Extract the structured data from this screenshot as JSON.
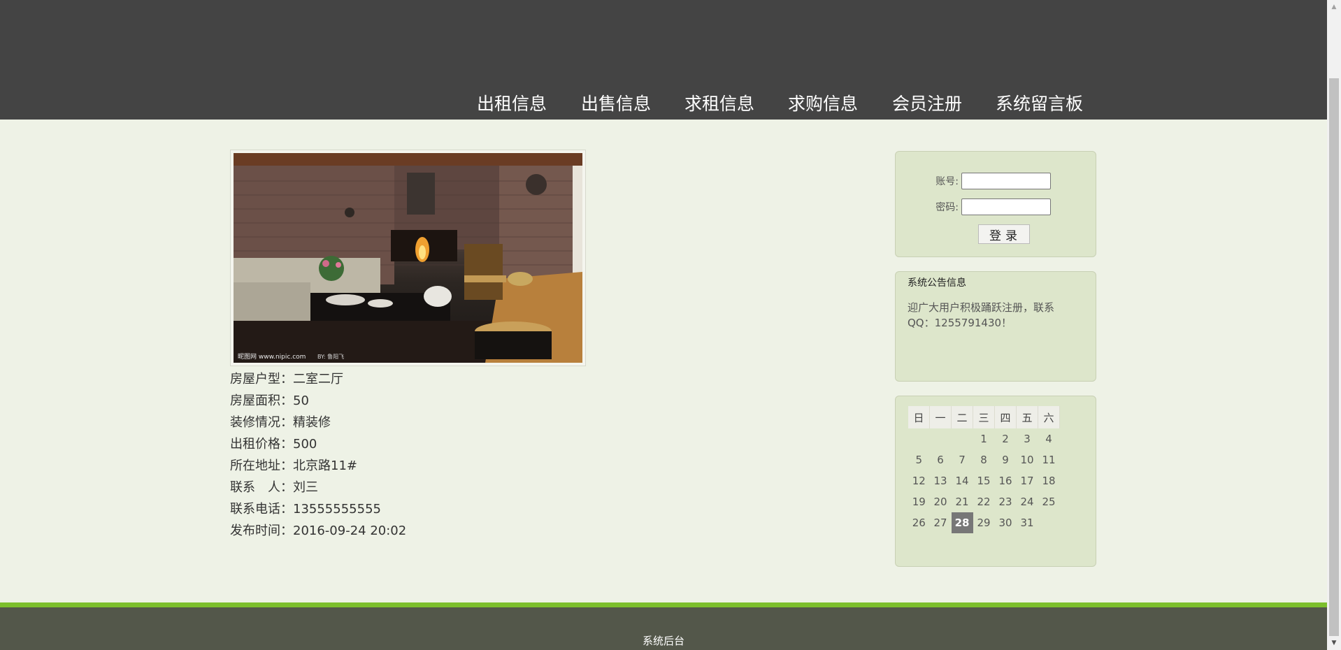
{
  "nav": [
    {
      "label": "出租信息"
    },
    {
      "label": "出售信息"
    },
    {
      "label": "求租信息"
    },
    {
      "label": "求购信息"
    },
    {
      "label": "会员注册"
    },
    {
      "label": "系统留言板"
    }
  ],
  "listing": {
    "image_watermark_left": "昵图网 www.nipic.com",
    "image_watermark_right": "BY: 鲁阳飞",
    "fields": [
      {
        "label": "房屋户型：",
        "value": "二室二厅"
      },
      {
        "label": "房屋面积：",
        "value": "50"
      },
      {
        "label": "装修情况：",
        "value": "精装修"
      },
      {
        "label": "出租价格：",
        "value": "500"
      },
      {
        "label": "所在地址：",
        "value": "北京路11#"
      },
      {
        "label": "联系　人：",
        "value": "刘三"
      },
      {
        "label": "联系电话：",
        "value": "13555555555"
      },
      {
        "label": "发布时间：",
        "value": "2016-09-24 20:02"
      }
    ]
  },
  "login": {
    "account_label": "账号:",
    "password_label": "密码:",
    "account_value": "",
    "password_value": "",
    "submit_label": "登录"
  },
  "notice": {
    "title": "系统公告信息",
    "text": "迎广大用户积极踊跃注册，联系QQ：1255791430！"
  },
  "calendar": {
    "weekdays": [
      "日",
      "一",
      "二",
      "三",
      "四",
      "五",
      "六"
    ],
    "weeks": [
      [
        "",
        "",
        "",
        "1",
        "2",
        "3",
        "4"
      ],
      [
        "5",
        "6",
        "7",
        "8",
        "9",
        "10",
        "11"
      ],
      [
        "12",
        "13",
        "14",
        "15",
        "16",
        "17",
        "18"
      ],
      [
        "19",
        "20",
        "21",
        "22",
        "23",
        "24",
        "25"
      ],
      [
        "26",
        "27",
        "28",
        "29",
        "30",
        "31",
        ""
      ]
    ],
    "today": "28"
  },
  "footer": {
    "link_label": "系统后台"
  },
  "colors": {
    "header_bg": "#444444",
    "page_bg": "#eef2e6",
    "panel_bg": "#dde6cb",
    "accent_green": "#7cbf2c",
    "footer_bg": "#53574a",
    "today_bg": "#777777"
  }
}
